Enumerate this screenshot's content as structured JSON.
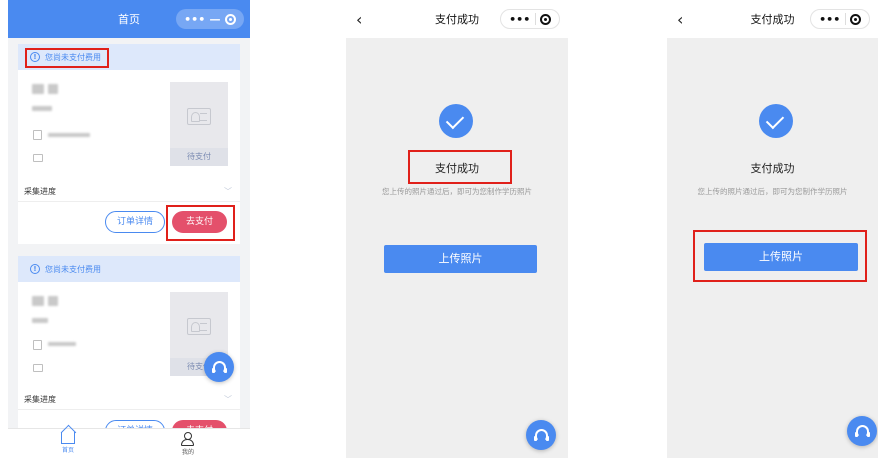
{
  "screen1": {
    "nav_title": "首页",
    "capsule_more": "•••",
    "capsule_min": "—",
    "card1": {
      "notice": "您尚未支付费用",
      "pending_label": "待支付",
      "progress_label": "采集进度",
      "details_button": "订单详情",
      "pay_button": "去支付"
    },
    "card2": {
      "notice": "您尚未支付费用",
      "pending_label": "待支付",
      "progress_label": "采集进度",
      "details_button": "订单详情",
      "pay_button": "去支付"
    },
    "tabs": {
      "home": "首页",
      "mine": "我的"
    },
    "accent": "#4a8af0",
    "pay_color": "#e4506b",
    "highlight_color": "#e0201a"
  },
  "screen2": {
    "nav_title": "支付成功",
    "capsule_more": "•••",
    "success_title": "支付成功",
    "success_desc": "您上传的照片通过后，即可为您制作学历照片",
    "upload_button": "上传照片"
  },
  "screen3": {
    "nav_title": "支付成功",
    "capsule_more": "•••",
    "success_title": "支付成功",
    "success_desc": "您上传的照片通过后，即可为您制作学历照片",
    "upload_button": "上传照片"
  }
}
